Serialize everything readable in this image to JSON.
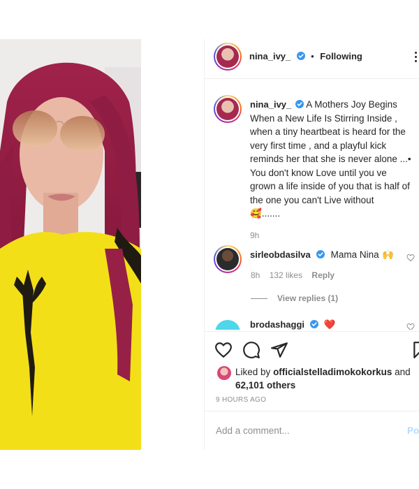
{
  "header": {
    "username": "nina_ivy_",
    "separator": "•",
    "follow_status": "Following",
    "more_icon": "more-dots-icon"
  },
  "caption": {
    "username": "nina_ivy_",
    "text": "A Mothers Joy Begins When a New Life Is Stirring Inside , when a tiny heartbeat is heard for the very first time , and a playful kick reminds her that she is never alone ...• You don't know Love until you ve grown a life inside of you that is half of the one you can't Live without",
    "emoji_suffix": "🥰",
    "ellipsis": ".......",
    "time": "9h"
  },
  "comments": [
    {
      "username": "sirleobdasilva",
      "text": "Mama Nina",
      "emoji": "🙌",
      "time": "8h",
      "likes": "132 likes",
      "reply": "Reply",
      "view_replies": "View replies (1)"
    },
    {
      "username": "brodashaggi",
      "text": "",
      "emoji": "❤️"
    }
  ],
  "actions": {
    "like_icon": "heart-icon",
    "comment_icon": "comment-icon",
    "share_icon": "paper-plane-icon",
    "save_icon": "bookmark-icon"
  },
  "likes": {
    "liked_by": "Liked by",
    "user": "officialstelladimokokorkus",
    "and": "and",
    "others": "62,101 others"
  },
  "time_ago": "9 HOURS AGO",
  "add_comment": {
    "placeholder": "Add a comment...",
    "post_label": "Post"
  },
  "colors": {
    "verified": "#3897f0",
    "heart_red": "#ed4956",
    "muted": "#8e8e8e",
    "post_disabled": "#b3dbff"
  }
}
